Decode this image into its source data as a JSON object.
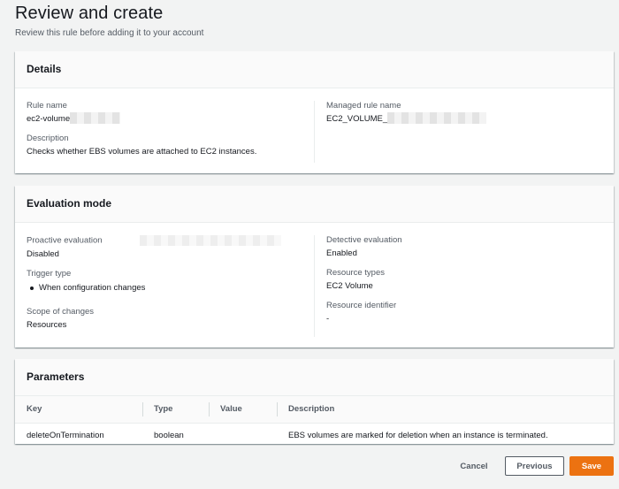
{
  "page": {
    "title": "Review and create",
    "subtitle": "Review this rule before adding it to your account"
  },
  "details": {
    "header": "Details",
    "rule_name_label": "Rule name",
    "rule_name_value": "ec2-volume",
    "description_label": "Description",
    "description_value": "Checks whether EBS volumes are attached to EC2 instances.",
    "managed_rule_label": "Managed rule name",
    "managed_rule_value": "EC2_VOLUME_"
  },
  "evaluation": {
    "header": "Evaluation mode",
    "proactive_label": "Proactive evaluation",
    "proactive_value": "Disabled",
    "trigger_label": "Trigger type",
    "trigger_items": [
      "When configuration changes"
    ],
    "scope_label": "Scope of changes",
    "scope_value": "Resources",
    "detective_label": "Detective evaluation",
    "detective_value": "Enabled",
    "resource_types_label": "Resource types",
    "resource_types_value": "EC2 Volume",
    "resource_id_label": "Resource identifier",
    "resource_id_value": "-"
  },
  "parameters": {
    "header": "Parameters",
    "columns": [
      "Key",
      "Type",
      "Value",
      "Description"
    ],
    "rows": [
      {
        "key": "deleteOnTermination",
        "type": "boolean",
        "value": "",
        "description": "EBS volumes are marked for deletion when an instance is terminated."
      }
    ]
  },
  "actions": {
    "cancel": "Cancel",
    "previous": "Previous",
    "save": "Save"
  },
  "colors": {
    "primary": "#ec7211",
    "text": "#16191f",
    "muted": "#545b64",
    "background": "#f2f3f3"
  }
}
